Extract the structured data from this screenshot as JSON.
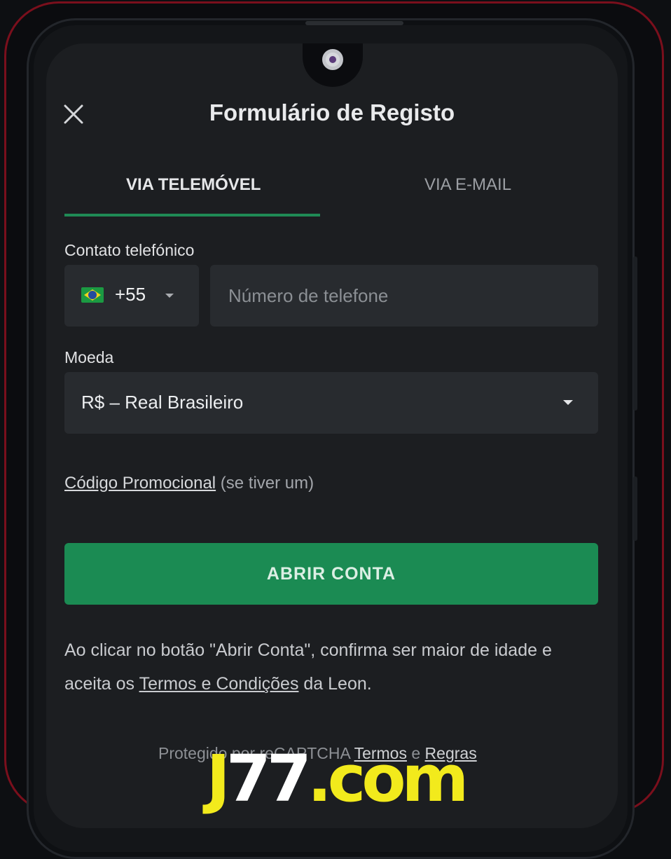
{
  "header": {
    "title": "Formulário de Registo",
    "close_icon": "close-icon"
  },
  "tabs": [
    {
      "label": "VIA TELEMÓVEL",
      "active": true
    },
    {
      "label": "VIA E-MAIL",
      "active": false
    }
  ],
  "phone": {
    "label": "Contato telefónico",
    "country_code": "+55",
    "country_flag": "brazil-flag-icon",
    "placeholder": "Número de telefone",
    "value": ""
  },
  "currency": {
    "label": "Moeda",
    "selected": "R$ – Real Brasileiro"
  },
  "promo": {
    "link": "Código Promocional",
    "suffix": " (se tiver um)"
  },
  "cta": {
    "label": "ABRIR CONTA"
  },
  "terms": {
    "text_before": "Ao clicar no botão \"Abrir Conta\", confirma ser maior de idade e aceita os ",
    "link": "Termos e Condições",
    "text_after": " da Leon."
  },
  "recaptcha": {
    "prefix": "Protegido por reCAPTCHA",
    "terms_link": "Termos",
    "conj": "e",
    "rules_link": "Regras"
  },
  "watermark": {
    "j": "J",
    "num": "77",
    "dot_com": ".com"
  },
  "colors": {
    "accent": "#1b8b53",
    "frame": "#7a0f1c",
    "watermark_yellow": "#f2ea1c"
  }
}
